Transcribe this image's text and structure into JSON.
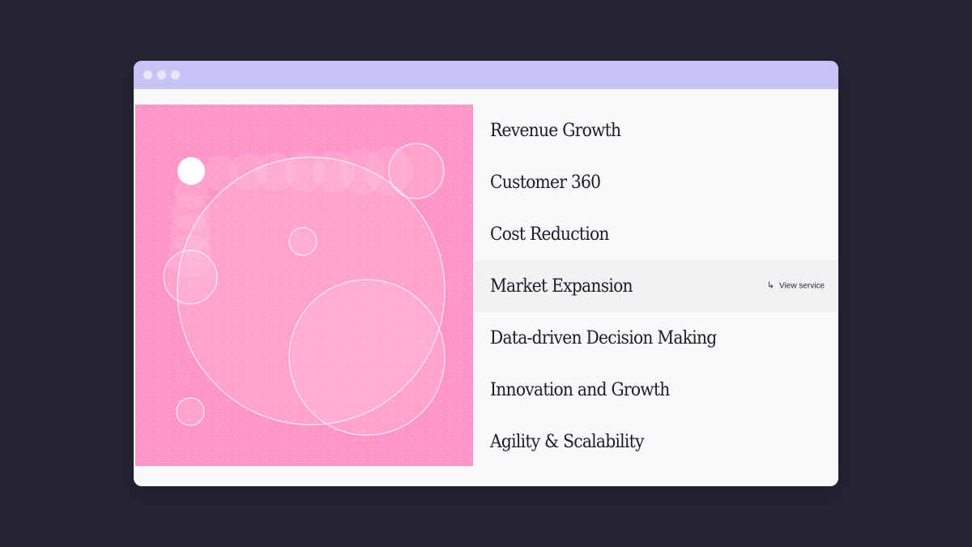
{
  "window": {
    "titlebar_color": "#c8c3f5",
    "controls": [
      "dot",
      "dot",
      "dot"
    ]
  },
  "illustration": {
    "background_color": "#ff96c8",
    "pattern": "dot-grid",
    "shapes": "translucent-circles"
  },
  "menu": {
    "items": [
      {
        "label": "Revenue Growth"
      },
      {
        "label": "Customer 360"
      },
      {
        "label": "Cost Reduction"
      },
      {
        "label": "Market Expansion",
        "active": true
      },
      {
        "label": "Data-driven Decision Making"
      },
      {
        "label": "Innovation and Growth"
      },
      {
        "label": "Agility & Scalability"
      }
    ],
    "active_index": 3,
    "active_background": "#f0f2f3",
    "view_service": {
      "icon": "return-arrow-icon",
      "label": "View service"
    }
  }
}
